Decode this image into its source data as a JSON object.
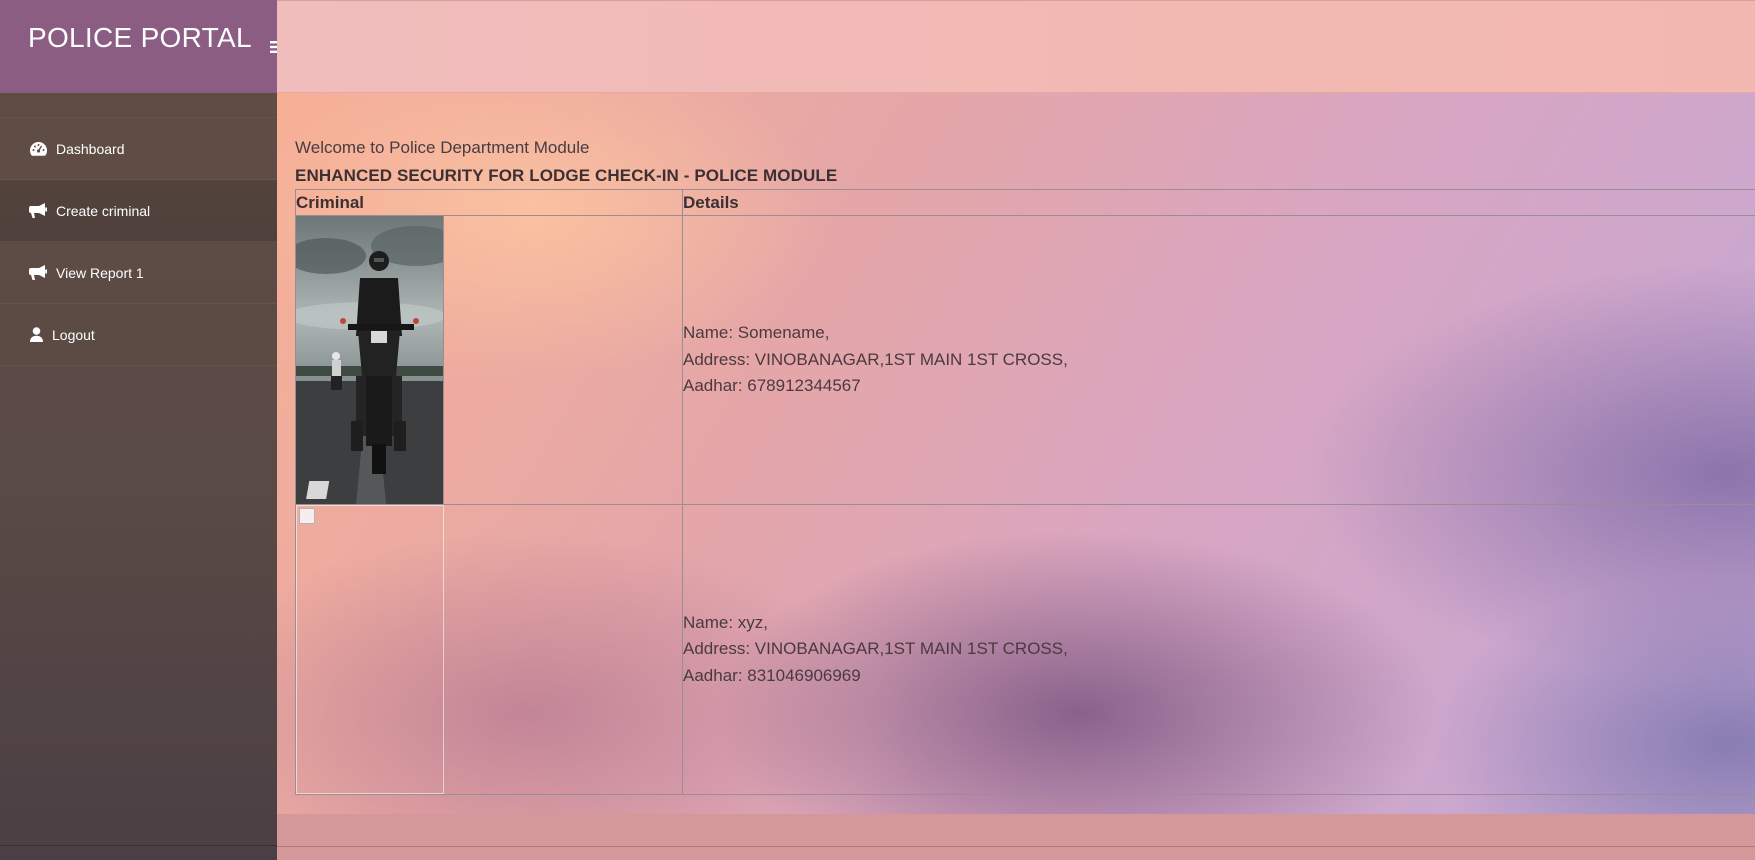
{
  "brand": {
    "title": "POLICE PORTAL",
    "menu_icon": "hamburger-icon"
  },
  "sidebar": {
    "items": [
      {
        "label": "Dashboard",
        "icon": "dashboard-icon"
      },
      {
        "label": "Create criminal",
        "icon": "megaphone-icon",
        "active": true
      },
      {
        "label": "View Report 1",
        "icon": "megaphone-icon"
      },
      {
        "label": "Logout",
        "icon": "user-icon"
      }
    ]
  },
  "main": {
    "welcome": "Welcome to Police Department Module",
    "heading": "ENHANCED SECURITY FOR LODGE CHECK-IN - POLICE MODULE",
    "table": {
      "columns": [
        "Criminal",
        "Details"
      ],
      "rows": [
        {
          "name": "Name: Somename,",
          "address": "Address: VINOBANAGAR,1ST MAIN 1ST CROSS,",
          "aadhar": "Aadhar: 678912344567",
          "photo": "motorcycle-rider-photo"
        },
        {
          "name": "Name: xyz,",
          "address": "Address: VINOBANAGAR,1ST MAIN 1ST CROSS,",
          "aadhar": "Aadhar: 831046906969",
          "photo": "broken-image"
        }
      ]
    }
  },
  "colors": {
    "brand": "#8b5d82",
    "sidebar": "#5a4a45",
    "header": "#f2b9b3"
  }
}
